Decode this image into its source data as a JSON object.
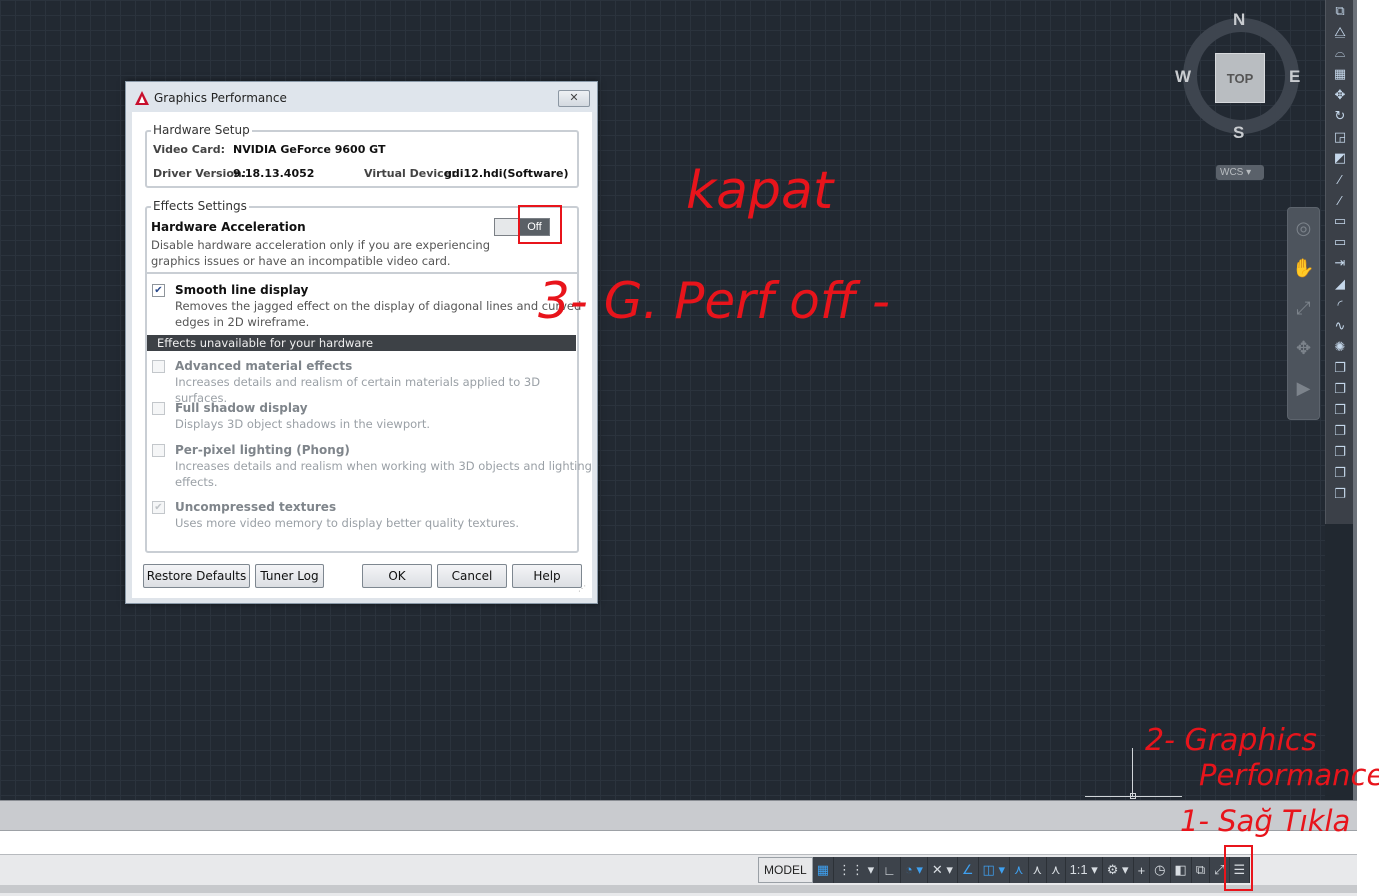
{
  "dialog": {
    "title": "Graphics Performance",
    "close_label": "✕",
    "hardware_setup": {
      "group_label": "Hardware Setup",
      "video_card_label": "Video Card:",
      "video_card_value": "NVIDIA GeForce 9600 GT",
      "driver_version_label": "Driver Version:",
      "driver_version_value": "9.18.13.4052",
      "virtual_device_label": "Virtual Device:",
      "virtual_device_value": "gdi12.hdi(Software)"
    },
    "effects": {
      "group_label": "Effects Settings",
      "hw_accel_title": "Hardware Acceleration",
      "hw_accel_toggle": "Off",
      "hw_accel_desc_1": "Disable hardware acceleration only if you are experiencing",
      "hw_accel_desc_2": "graphics issues or have an incompatible video card.",
      "smooth_title": "Smooth line display",
      "smooth_checked": true,
      "smooth_desc_1": "Removes the jagged effect on the display of diagonal lines and curved",
      "smooth_desc_2": "edges in 2D wireframe.",
      "unavailable_header": "Effects unavailable for your hardware",
      "adv_title": "Advanced material effects",
      "adv_desc": "Increases details and realism of certain materials applied to 3D surfaces.",
      "shadow_title": "Full shadow display",
      "shadow_desc": "Displays 3D object shadows in the viewport.",
      "pixel_title": "Per-pixel lighting (Phong)",
      "pixel_desc_1": "Increases details and realism when working with 3D objects and lighting",
      "pixel_desc_2": "effects.",
      "tex_title": "Uncompressed textures",
      "tex_checked": true,
      "tex_desc": "Uses more video memory to display better quality textures."
    },
    "buttons": {
      "restore": "Restore Defaults",
      "tuner": "Tuner Log",
      "ok": "OK",
      "cancel": "Cancel",
      "help": "Help"
    }
  },
  "viewcube": {
    "n": "N",
    "s": "S",
    "e": "E",
    "w": "W",
    "top": "TOP",
    "wcs": "WCS ▾"
  },
  "statusbar": {
    "model": "MODEL",
    "scale": "1:1 ▾"
  },
  "annotations": {
    "kapat": "kapat",
    "step3": "3- G. Perf off -",
    "step2a": "2- Graphics",
    "step2b": "Performance",
    "step1": "1- Sağ Tıkla"
  },
  "colors": {
    "annotation": "#e8141b",
    "canvas": "#222932",
    "dialog_bg": "#ffffff"
  }
}
